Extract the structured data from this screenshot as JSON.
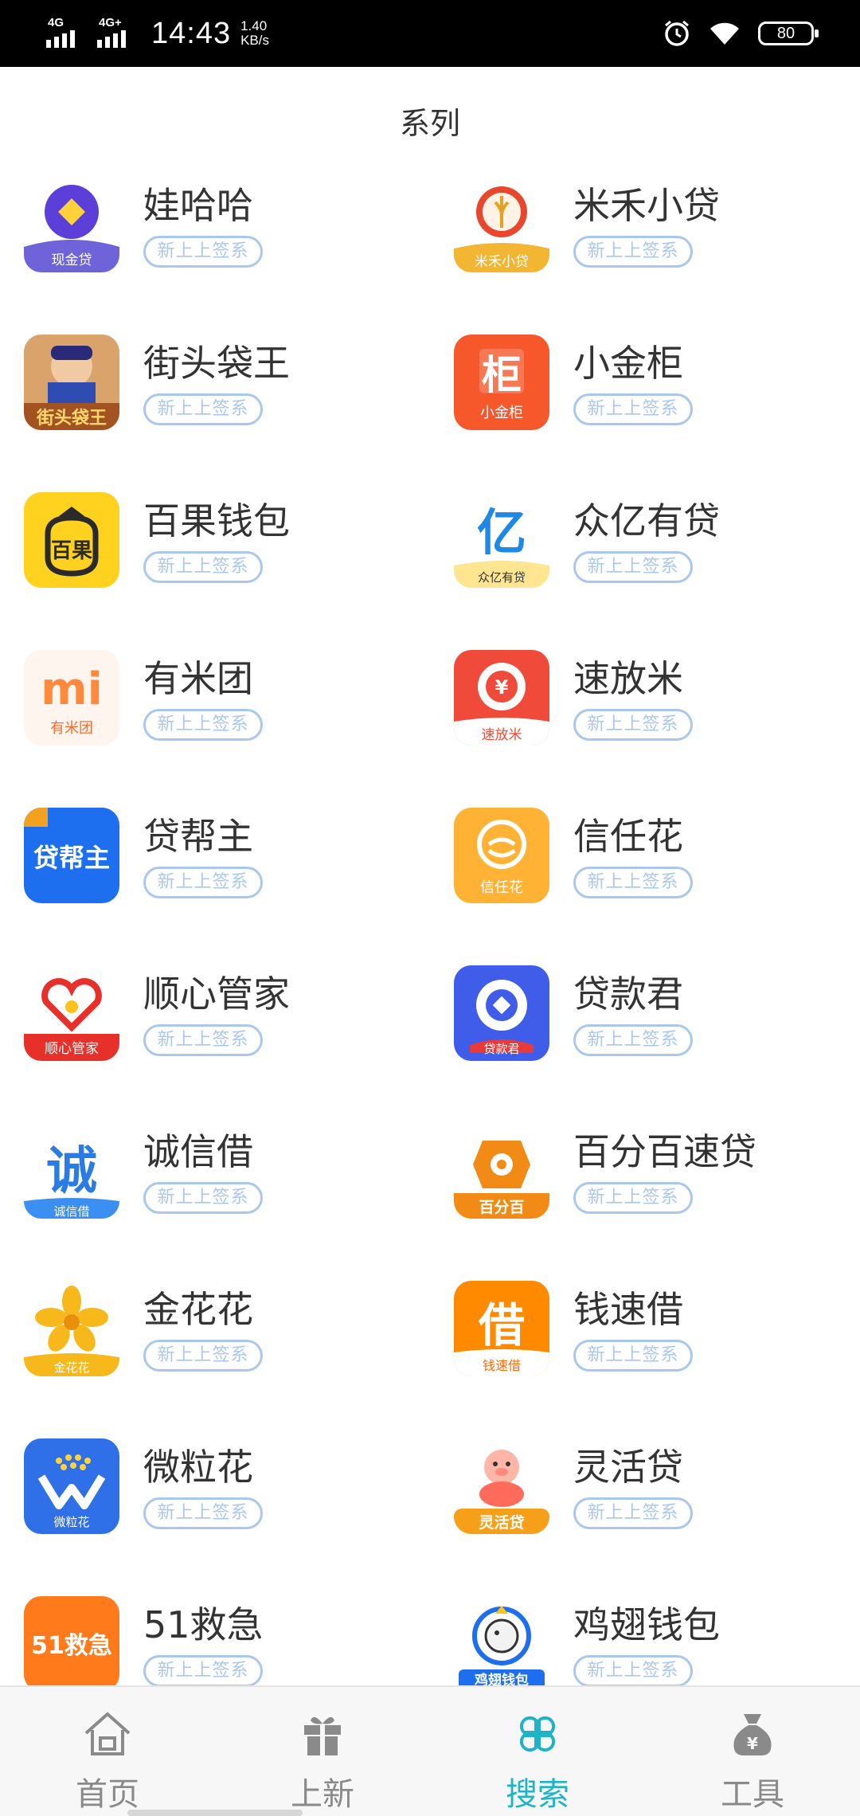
{
  "status_bar": {
    "signal1": "4G",
    "signal2": "4G+",
    "time": "14:43",
    "speed_value": "1.40",
    "speed_unit": "KB/s",
    "battery": "80"
  },
  "header": {
    "title": "系列"
  },
  "tag_label": "新上上签系",
  "apps": [
    {
      "name": "娃哈哈",
      "tag": "新上上签系",
      "icon_text": "现金贷",
      "icon": "wahaha-icon"
    },
    {
      "name": "米禾小贷",
      "tag": "新上上签系",
      "icon_text": "米禾小贷",
      "icon": "mihe-icon"
    },
    {
      "name": "街头袋王",
      "tag": "新上上签系",
      "icon_text": "街头袋王",
      "icon": "jietou-icon"
    },
    {
      "name": "小金柜",
      "tag": "新上上签系",
      "icon_text": "小金柜",
      "icon": "xiaojingui-icon"
    },
    {
      "name": "百果钱包",
      "tag": "新上上签系",
      "icon_text": "百果",
      "icon": "baiguo-icon"
    },
    {
      "name": "众亿有贷",
      "tag": "新上上签系",
      "icon_text": "众亿有贷",
      "icon": "zhongyi-icon"
    },
    {
      "name": "有米团",
      "tag": "新上上签系",
      "icon_text": "有米团",
      "icon": "youmi-icon"
    },
    {
      "name": "速放米",
      "tag": "新上上签系",
      "icon_text": "速放米",
      "icon": "sufangmi-icon"
    },
    {
      "name": "贷帮主",
      "tag": "新上上签系",
      "icon_text": "贷帮主",
      "icon": "daibangzhu-icon"
    },
    {
      "name": "信任花",
      "tag": "新上上签系",
      "icon_text": "信任花",
      "icon": "xinrenhua-icon"
    },
    {
      "name": "顺心管家",
      "tag": "新上上签系",
      "icon_text": "顺心管家",
      "icon": "shunxin-icon"
    },
    {
      "name": "贷款君",
      "tag": "新上上签系",
      "icon_text": "贷款君",
      "icon": "daikuanjun-icon"
    },
    {
      "name": "诚信借",
      "tag": "新上上签系",
      "icon_text": "诚信借",
      "icon": "chengxin-icon"
    },
    {
      "name": "百分百速贷",
      "tag": "新上上签系",
      "icon_text": "百分百",
      "icon": "baifenbai-icon"
    },
    {
      "name": "金花花",
      "tag": "新上上签系",
      "icon_text": "金花花",
      "icon": "jinhuahua-icon"
    },
    {
      "name": "钱速借",
      "tag": "新上上签系",
      "icon_text": "钱速借",
      "icon": "qiansujie-icon"
    },
    {
      "name": "微粒花",
      "tag": "新上上签系",
      "icon_text": "微粒花",
      "icon": "weilihua-icon"
    },
    {
      "name": "灵活贷",
      "tag": "新上上签系",
      "icon_text": "灵活贷",
      "icon": "linghuodai-icon"
    },
    {
      "name": "51救急",
      "tag": "新上上签系",
      "icon_text": "51救急",
      "icon": "jiuji-icon"
    },
    {
      "name": "鸡翅钱包",
      "tag": "新上上签系",
      "icon_text": "鸡翅钱包",
      "icon": "jichi-icon"
    }
  ],
  "bottom_nav": [
    {
      "label": "首页",
      "icon": "home-icon",
      "active": false
    },
    {
      "label": "上新",
      "icon": "gift-icon",
      "active": false
    },
    {
      "label": "搜索",
      "icon": "clover-icon",
      "active": true
    },
    {
      "label": "工具",
      "icon": "money-bag-icon",
      "active": false
    }
  ],
  "colors": {
    "tag_border": "#a9c7ef",
    "active_nav": "#1fb3c9",
    "inactive_nav": "#8a8a8a"
  }
}
